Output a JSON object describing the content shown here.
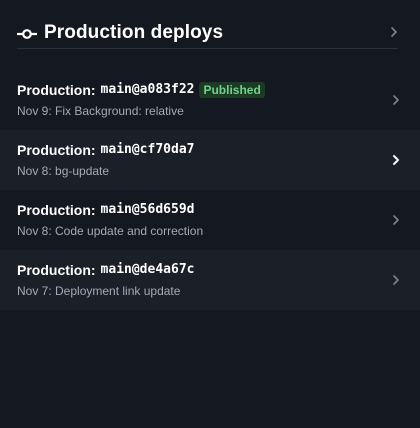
{
  "header": {
    "title": "Production deploys",
    "icon": "commit-icon"
  },
  "deploys": [
    {
      "prefix": "Production:",
      "ref": "main@a083f22",
      "badge": "Published",
      "subtitle": "Nov 9: Fix Background: relative"
    },
    {
      "prefix": "Production:",
      "ref": "main@cf70da7",
      "subtitle": "Nov 8: bg-update"
    },
    {
      "prefix": "Production:",
      "ref": "main@56d659d",
      "subtitle": "Nov 8: Code update and correction"
    },
    {
      "prefix": "Production:",
      "ref": "main@de4a67c",
      "subtitle": "Nov 7: Deployment link update"
    }
  ],
  "colors": {
    "background": "#141820",
    "row_alt": "#1a1f28",
    "badge_bg": "#1d3a24",
    "badge_text": "#6fd28a",
    "muted_text": "#a4abb6"
  }
}
